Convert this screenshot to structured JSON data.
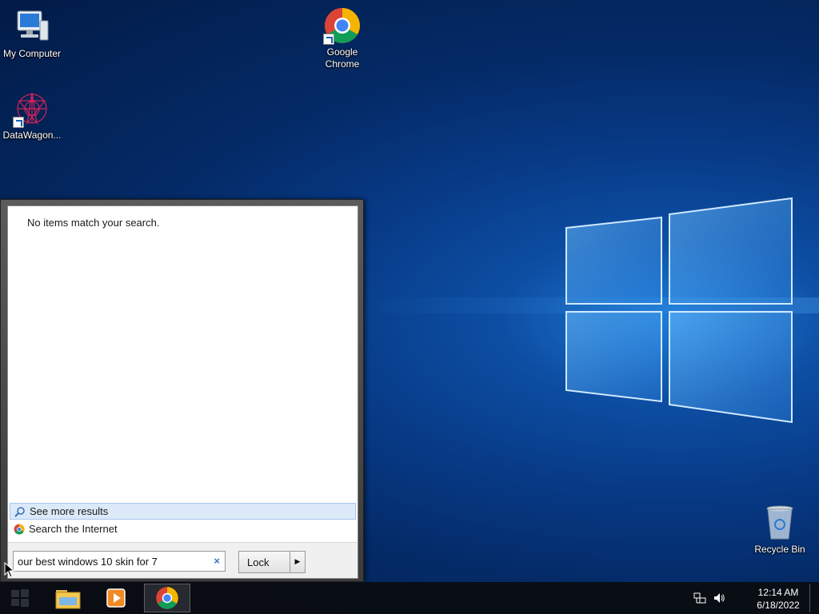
{
  "desktop": {
    "icons": [
      {
        "label": "My Computer"
      },
      {
        "label": "Google Chrome"
      },
      {
        "label": "DataWagon..."
      },
      {
        "label": "Recycle Bin"
      }
    ]
  },
  "start_menu": {
    "no_results_text": "No items match your search.",
    "see_more_label": "See more results",
    "search_internet_label": "Search the Internet",
    "search_value": "our best windows 10 skin for 7",
    "search_clear": "×",
    "power_button_label": "Lock"
  },
  "taskbar": {
    "clock_time": "12:14 AM",
    "clock_date": "6/18/2022",
    "pinned": [
      {
        "icon": "file-explorer-icon"
      },
      {
        "icon": "media-player-icon"
      },
      {
        "icon": "chrome-icon",
        "active": true
      }
    ]
  },
  "colors": {
    "accent": "#1e7bd6",
    "desktop_dark": "#021b47",
    "highlight": "#dbe9f8"
  }
}
